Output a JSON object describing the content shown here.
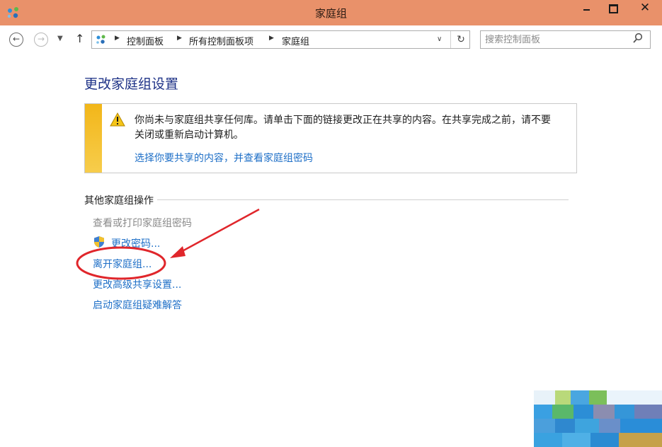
{
  "window": {
    "title": "家庭组",
    "minimize_icon": "minimize-icon",
    "maximize_icon": "maximize-icon",
    "close_glyph": "✕"
  },
  "nav": {
    "back_glyph": "←",
    "forward_glyph": "→",
    "dropdown_glyph": "▼",
    "up_glyph": "↑",
    "breadcrumbs": [
      "控制面板",
      "所有控制面板项",
      "家庭组"
    ],
    "separator_glyph": "▶",
    "address_dropdown_glyph": "∨",
    "refresh_glyph": "↻",
    "search_placeholder": "搜索控制面板",
    "search_glyph": "⚲"
  },
  "main": {
    "title": "更改家庭组设置",
    "notice": {
      "text": "你尚未与家庭组共享任何库。请单击下面的链接更改正在共享的内容。在共享完成之前，请不要关闭或重新启动计算机。",
      "link": "选择你要共享的内容，并查看家庭组密码"
    },
    "section_title": "其他家庭组操作",
    "tasks": [
      {
        "label": "查看或打印家庭组密码",
        "enabled": false
      },
      {
        "label": "更改密码...",
        "enabled": true
      },
      {
        "label": "离开家庭组...",
        "enabled": true
      },
      {
        "label": "更改高级共享设置...",
        "enabled": true
      },
      {
        "label": "启动家庭组疑难解答",
        "enabled": true
      }
    ]
  },
  "colors": {
    "titlebar": "#e9916a",
    "link": "#1e6fc7",
    "heading": "#1e3287",
    "warning_stripe": "#f2b619",
    "annotation": "#e0262b"
  }
}
